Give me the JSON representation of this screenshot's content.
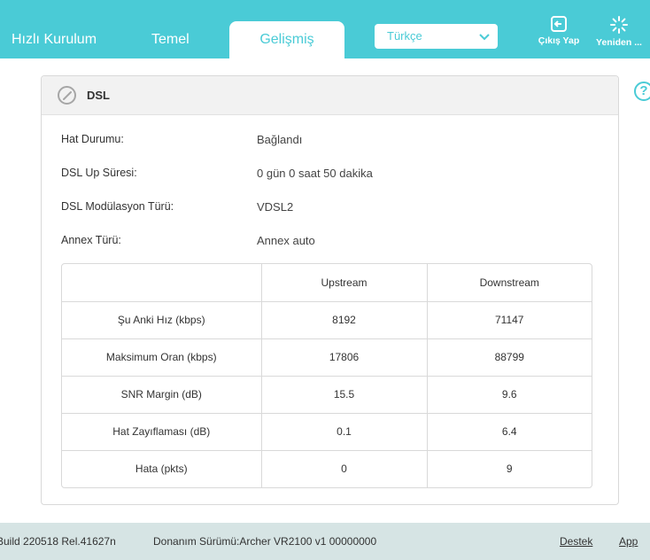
{
  "nav": {
    "tabs": [
      {
        "label": "Hızlı Kurulum",
        "active": false
      },
      {
        "label": "Temel",
        "active": false
      },
      {
        "label": "Gelişmiş",
        "active": true
      }
    ],
    "language": "Türkçe",
    "logout_label": "Çıkış Yap",
    "reboot_label": "Yeniden ..."
  },
  "panel": {
    "title": "DSL",
    "info": [
      {
        "label": "Hat Durumu:",
        "value": "Bağlandı"
      },
      {
        "label": "DSL Up Süresi:",
        "value": "0 gün 0 saat 50 dakika"
      },
      {
        "label": "DSL Modülasyon Türü:",
        "value": "VDSL2"
      },
      {
        "label": "Annex Türü:",
        "value": "Annex auto"
      }
    ],
    "table": {
      "headers": [
        "",
        "Upstream",
        "Downstream"
      ],
      "rows": [
        [
          "Şu Anki Hız (kbps)",
          "8192",
          "71147"
        ],
        [
          "Maksimum Oran (kbps)",
          "17806",
          "88799"
        ],
        [
          "SNR Margin (dB)",
          "15.5",
          "9.6"
        ],
        [
          "Hat Zayıflaması (dB)",
          "0.1",
          "6.4"
        ],
        [
          "Hata (pkts)",
          "0",
          "9"
        ]
      ]
    }
  },
  "footer": {
    "firmware": "Build 220518 Rel.41627n",
    "hardware": "Donanım Sürümü:Archer VR2100 v1 00000000",
    "support": "Destek",
    "app": "App"
  },
  "colors": {
    "accent": "#4acbd6",
    "footer_bg": "#d6e4e4"
  }
}
